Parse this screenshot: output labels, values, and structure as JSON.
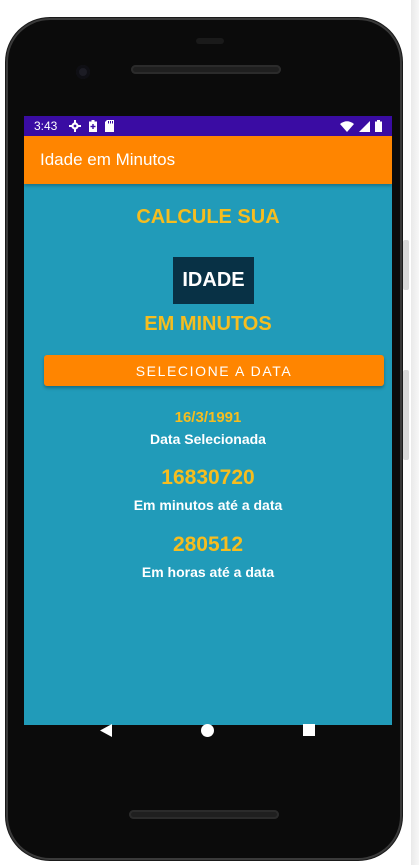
{
  "status_bar": {
    "time": "3:43",
    "left_icons": [
      "gear-icon",
      "battery-saver-icon",
      "sd-card-icon"
    ],
    "right_icons": [
      "wifi-icon",
      "signal-icon",
      "battery-icon"
    ],
    "color": "#3a0ca3"
  },
  "app_bar": {
    "title": "Idade em Minutos",
    "color": "#ff8500"
  },
  "main": {
    "background": "#219bb9",
    "heading_top": "CALCULE SUA",
    "heading_box": "IDADE",
    "heading_bottom": "EM MINUTOS",
    "select_button": "SELECIONE A DATA",
    "selected_date": "16/3/1991",
    "selected_date_label": "Data Selecionada",
    "minutes_value": "16830720",
    "minutes_label": "Em minutos até a data",
    "hours_value": "280512",
    "hours_label": "Em horas até a data",
    "accent_color": "#f6bd1f"
  },
  "nav_bar": {
    "buttons": [
      "back-icon",
      "home-icon",
      "recents-icon"
    ]
  }
}
